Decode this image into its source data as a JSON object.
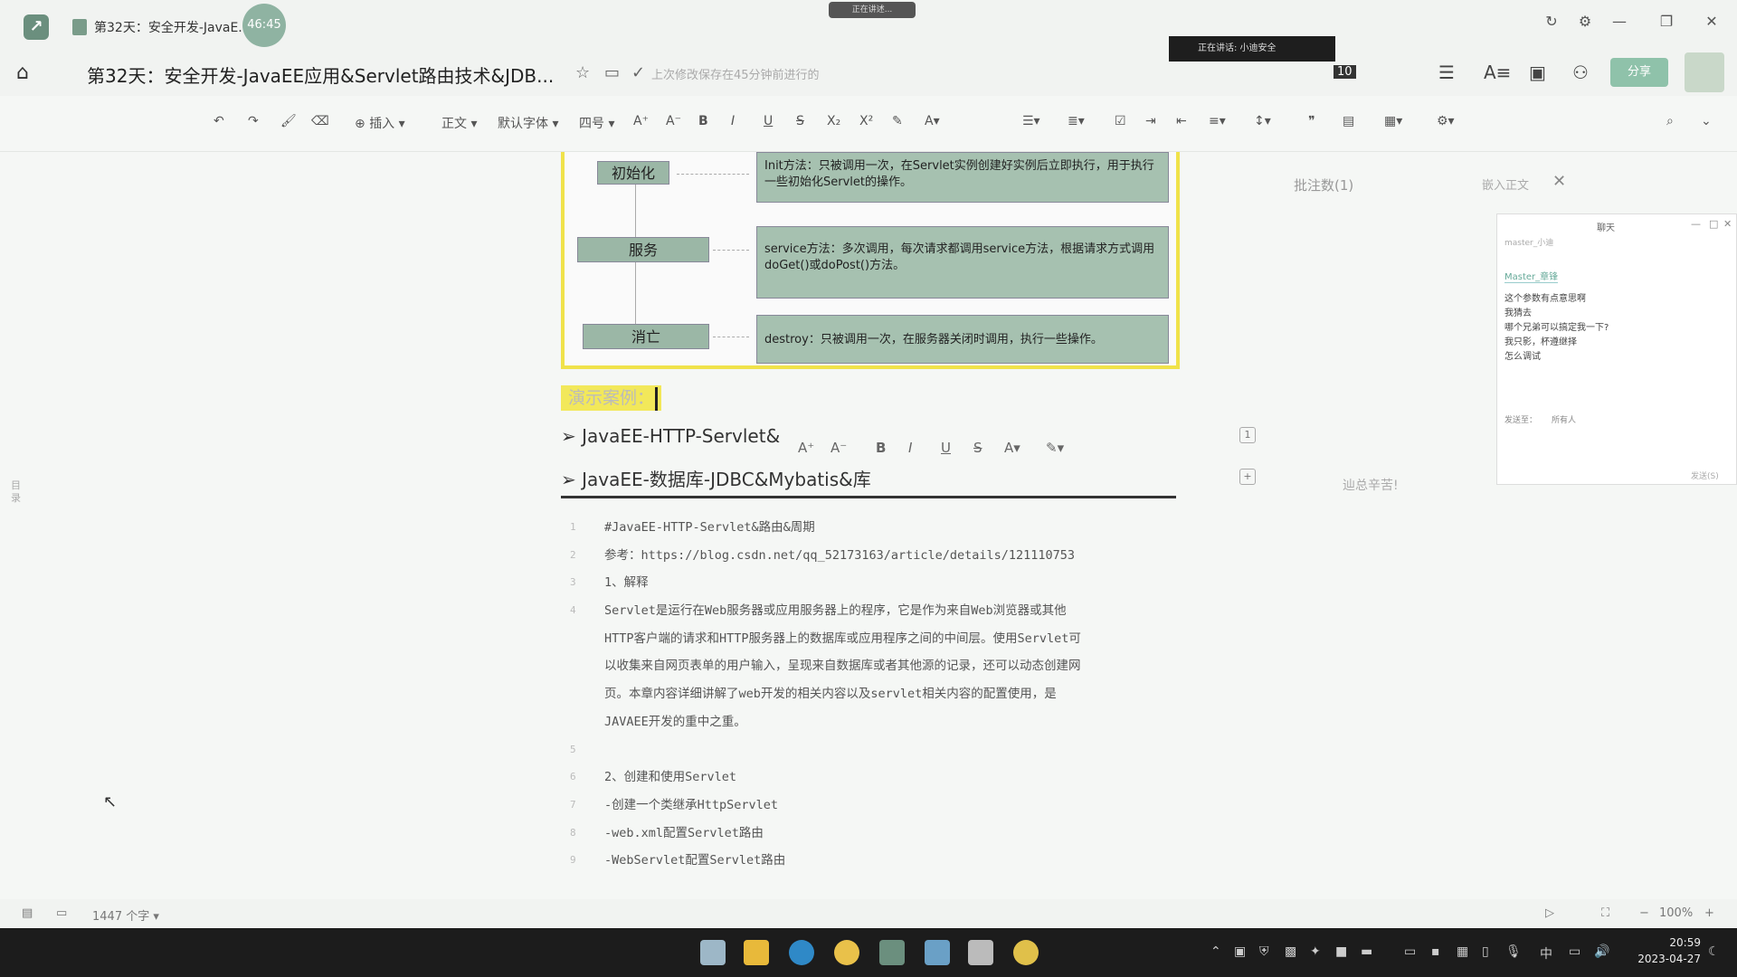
{
  "titlebar": {
    "tab_title": "第32天：安全开发-JavaE...",
    "timer": "46:45",
    "recording_label": "正在讲述..."
  },
  "header": {
    "doc_title": "第32天：安全开发-JavaEE应用&Servlet路由技术&JDB...",
    "save_status": "上次修改保存在45分钟前进行的",
    "speaker_label": "正在讲话: 小迪安全",
    "participant_count": "10",
    "share_button": "分享"
  },
  "toolbar": {
    "insert": "插入",
    "style": "正文",
    "font": "默认字体",
    "size": "四号",
    "bold": "B",
    "italic": "I",
    "underline": "U",
    "strike": "S"
  },
  "diagram": {
    "stages": [
      {
        "label": "初始化",
        "desc": "Init方法：只被调用一次，在Servlet实例创建好实例后立即执行，用于执行一些初始化Servlet的操作。"
      },
      {
        "label": "服务",
        "desc": "service方法：多次调用，每次请求都调用service方法，根据请求方式调用doGet()或doPost()方法。"
      },
      {
        "label": "消亡",
        "desc": "destroy：只被调用一次，在服务器关闭时调用，执行一些操作。"
      }
    ]
  },
  "content": {
    "demo_heading": "演示案例：",
    "bullets": [
      "➢ JavaEE-HTTP-Servlet&",
      "➢ JavaEE-数据库-JDBC&Mybatis&库"
    ],
    "code_lines": [
      "#JavaEE-HTTP-Servlet&路由&周期",
      "参考：https://blog.csdn.net/qq_52173163/article/details/121110753",
      "1、解释",
      "Servlet是运行在Web服务器或应用服务器上的程序，它是作为来自Web浏览器或其他",
      "HTTP客户端的请求和HTTP服务器上的数据库或应用程序之间的中间层。使用Servlet可",
      "以收集来自网页表单的用户输入，呈现来自数据库或者其他源的记录，还可以动态创建网",
      "页。本章内容详细讲解了web开发的相关内容以及servlet相关内容的配置使用，是",
      "JAVAEE开发的重中之重。",
      "",
      "2、创建和使用Servlet",
      "-创建一个类继承HttpServlet",
      "-web.xml配置Servlet路由",
      "-WebServlet配置Servlet路由"
    ]
  },
  "comments": {
    "count_label": "批注数(1)",
    "insert_label": "嵌入正文",
    "side_note": "辿总辛苦!"
  },
  "chat": {
    "title": "聊天",
    "user": "master_小迪",
    "name": "Master_章锋",
    "messages": [
      "这个参数有点意思啊",
      "我猜去",
      "哪个兄弟可以搞定我一下?",
      "我只影，杯遵继择",
      "怎么调试"
    ],
    "send_to_label": "发送至：",
    "send_to_value": "所有人",
    "send_button": "发送(S)"
  },
  "sidebar": {
    "toc_label": "目录"
  },
  "statusbar": {
    "word_count": "1447 个字",
    "zoom": "100%"
  },
  "taskbar": {
    "ime": "中",
    "time": "20:59",
    "date": "2023-04-27"
  }
}
